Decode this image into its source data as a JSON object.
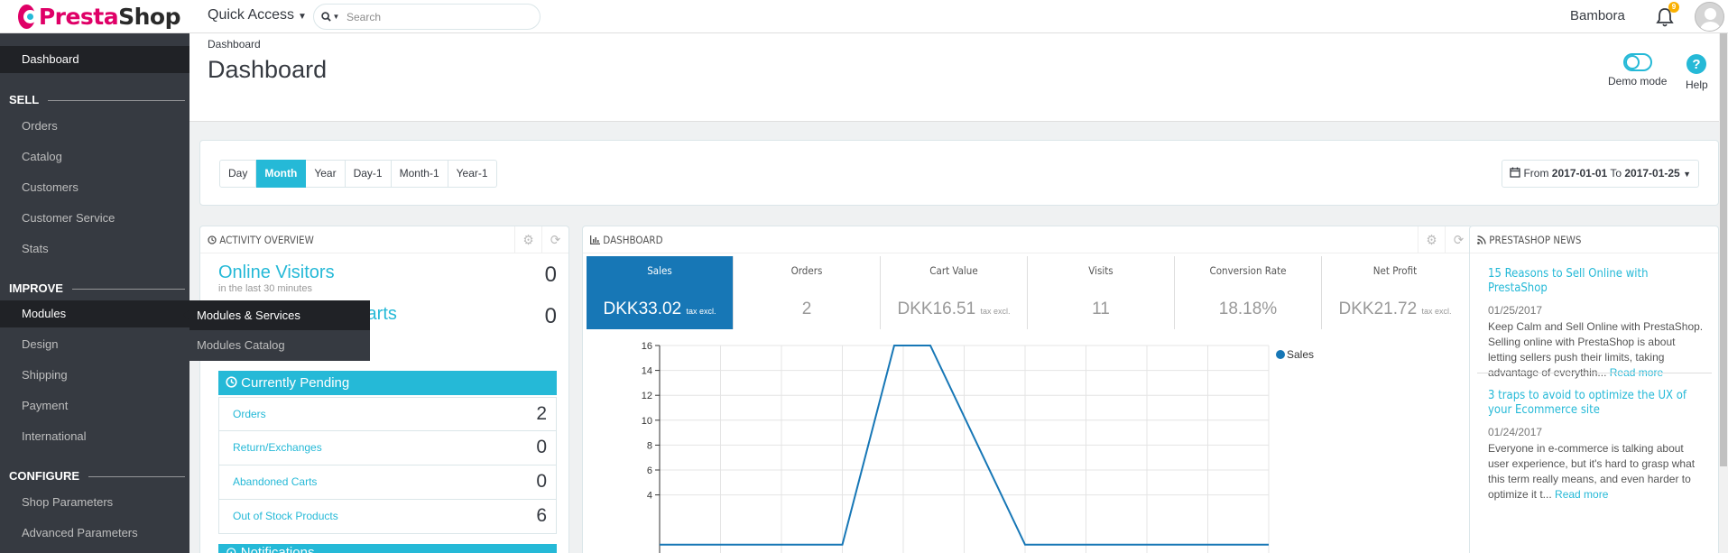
{
  "header": {
    "logo_part1": "Presta",
    "logo_part2": "Shop",
    "quick_access": "Quick Access",
    "search_placeholder": "Search",
    "employee": "Bambora",
    "notifications_count": "9"
  },
  "sidebar": {
    "dashboard": "Dashboard",
    "sections": {
      "sell": "SELL",
      "improve": "IMPROVE",
      "configure": "CONFIGURE"
    },
    "sell_items": [
      "Orders",
      "Catalog",
      "Customers",
      "Customer Service",
      "Stats"
    ],
    "improve_items": [
      "Modules",
      "Design",
      "Shipping",
      "Payment",
      "International"
    ],
    "configure_items": [
      "Shop Parameters",
      "Advanced Parameters"
    ],
    "submenu": [
      "Modules & Services",
      "Modules Catalog"
    ]
  },
  "page": {
    "breadcrumb": "Dashboard",
    "title": "Dashboard",
    "demo_mode": "Demo mode",
    "help": "Help"
  },
  "period": {
    "buttons": [
      "Day",
      "Month",
      "Year",
      "Day-1",
      "Month-1",
      "Year-1"
    ],
    "active": "Month",
    "from_label": "From",
    "from_date": "2017-01-01",
    "to_label": "To",
    "to_date": "2017-01-25"
  },
  "activity": {
    "title": "ACTIVITY OVERVIEW",
    "online_visitors_label": "Online Visitors",
    "online_visitors_sub": "in the last 30 minutes",
    "online_visitors_value": "0",
    "active_carts_label": "Active Shopping Carts",
    "active_carts_value": "0",
    "pending_title": "Currently Pending",
    "pending": [
      {
        "label": "Orders",
        "value": "2"
      },
      {
        "label": "Return/Exchanges",
        "value": "0"
      },
      {
        "label": "Abandoned Carts",
        "value": "0"
      },
      {
        "label": "Out of Stock Products",
        "value": "6"
      }
    ],
    "notifications_title": "Notifications"
  },
  "dashboard": {
    "title": "DASHBOARD",
    "kpis": [
      {
        "title": "Sales",
        "value": "DKK33.02",
        "suffix": "tax excl."
      },
      {
        "title": "Orders",
        "value": "2",
        "suffix": ""
      },
      {
        "title": "Cart Value",
        "value": "DKK16.51",
        "suffix": "tax excl."
      },
      {
        "title": "Visits",
        "value": "11",
        "suffix": ""
      },
      {
        "title": "Conversion Rate",
        "value": "18.18%",
        "suffix": ""
      },
      {
        "title": "Net Profit",
        "value": "DKK21.72",
        "suffix": "tax excl."
      }
    ]
  },
  "chart_data": {
    "type": "line",
    "legend": [
      "Sales"
    ],
    "legend_position": "top-right",
    "ylim": [
      0,
      16
    ],
    "yticks": [
      "16",
      "14",
      "12",
      "10",
      "8",
      "6",
      "4"
    ],
    "series": [
      {
        "name": "Sales",
        "color": "#1777b6",
        "x": [
          0,
          1,
          2,
          3,
          4,
          5,
          6,
          7,
          8,
          9,
          10
        ],
        "values": [
          0,
          0,
          0,
          0,
          16,
          16,
          0,
          0,
          0,
          0,
          0
        ]
      }
    ],
    "grid": true
  },
  "news": {
    "title": "PRESTASHOP NEWS",
    "items": [
      {
        "title": "15 Reasons to Sell Online with PrestaShop",
        "date": "01/25/2017",
        "body": "Keep Calm and Sell Online with PrestaShop. Selling online with PrestaShop is about letting sellers push their limits, taking advantage of everythin...",
        "more": "Read more"
      },
      {
        "title": "3 traps to avoid to optimize the UX of your Ecommerce site",
        "date": "01/24/2017",
        "body": "Everyone in e-commerce is talking about user experience, but it's hard to grasp what this term really means, and even harder to optimize it t...",
        "more": "Read more"
      }
    ]
  },
  "colors": {
    "brand": "#df0067",
    "accent": "#25b9d7",
    "sidebar": "#363a41",
    "kpi_active": "#1777b6"
  }
}
